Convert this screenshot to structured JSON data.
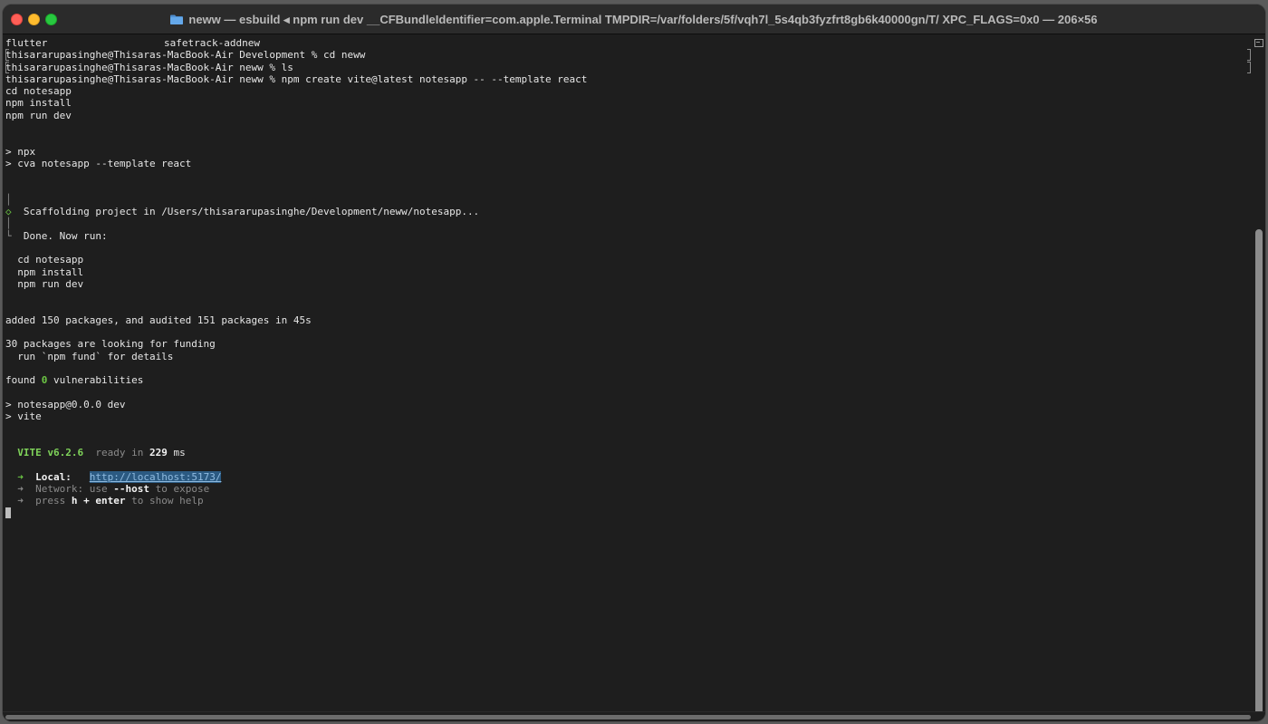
{
  "window": {
    "title": "neww — esbuild ◂ npm run dev __CFBundleIdentifier=com.apple.Terminal TMPDIR=/var/folders/5f/vqh7l_5s4qb3fyzfrt8gb6k40000gn/T/ XPC_FLAGS=0x0 — 206×56"
  },
  "terminal": {
    "ls_col1": "flutter",
    "ls_col2": "safetrack-addnew",
    "prompt1": "thisararupasinghe@Thisaras-MacBook-Air Development % cd neww",
    "prompt2": "thisararupasinghe@Thisaras-MacBook-Air neww % ls",
    "prompt3": "thisararupasinghe@Thisaras-MacBook-Air neww % npm create vite@latest notesapp -- --template react",
    "cmd_cd": "cd notesapp",
    "cmd_install": "npm install",
    "cmd_rundev": "npm run dev",
    "npx_line": "> npx",
    "cva_line": "> cva notesapp --template react",
    "gutter_pipe": "│",
    "diamond": "◇",
    "scaffold": "  Scaffolding project in /Users/thisararupasinghe/Development/neww/notesapp...",
    "corner": "└",
    "done": "  Done. Now run:",
    "run_cd": "  cd notesapp",
    "run_install": "  npm install",
    "run_dev": "  npm run dev",
    "added": "added 150 packages, and audited 151 packages in 45s",
    "funding": "30 packages are looking for funding",
    "fund_details": "  run `npm fund` for details",
    "found_prefix": "found ",
    "found_count": "0",
    "found_suffix": " vulnerabilities",
    "script_line": "> notesapp@0.0.0 dev",
    "vite_line": "> vite",
    "vite_name": "VITE v6.2.6",
    "ready_in": "ready in",
    "ready_ms": "229",
    "ms": "ms",
    "arrow": "➜",
    "local_label": "Local:",
    "local_url": "http://localhost:5173/",
    "network_label": "Network:",
    "network_use": "use",
    "network_flag": "--host",
    "network_expose": "to expose",
    "press": "press",
    "press_key": "h + enter",
    "press_help": "to show help"
  }
}
